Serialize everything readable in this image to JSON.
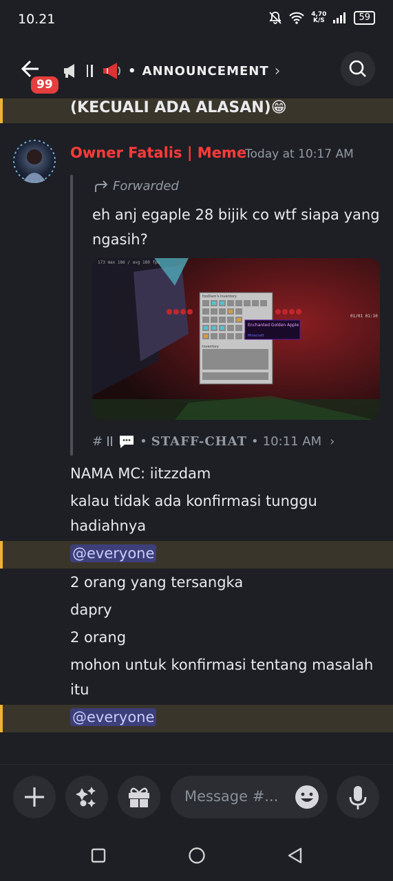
{
  "status": {
    "time": "10.21",
    "net_speed": "4,70",
    "net_unit": "K/S",
    "battery": "59"
  },
  "header": {
    "unread_count": "99",
    "bullet": "•",
    "channel_name": "ANNOUNCEMENT",
    "chevron": "›"
  },
  "messages": {
    "top_line": "(KECUALI ADA ALASAN)😁",
    "author": "Owner Fatalis | Meme",
    "timestamp": "Today at 10:17 AM",
    "forwarded_label": "Forwarded",
    "forwarded_text": "eh anj egaple 28 bijik co wtf siapa yang ngasih?",
    "forward_source": {
      "hash": "#",
      "channel": "STAFF-CHAT",
      "bullet": "•",
      "time": "10:11 AM",
      "chevron": "›"
    },
    "lines": [
      "NAMA MC: iitzzdam",
      "kalau tidak ada konfirmasi tunggu",
      "hadiahnya",
      "@everyone",
      "2 orang yang tersangka",
      "dapry",
      "2 orang",
      "mohon untuk konfirmasi tentang masalah",
      "itu",
      "@everyone"
    ]
  },
  "screenshot": {
    "inventory_title": "ItzzDam's Inventory",
    "inventory_label": "Inventory",
    "tooltip_title": "Enchanted Golden Apple",
    "tooltip_sub": "Minecraft"
  },
  "composer": {
    "placeholder": "Message #..."
  },
  "colors": {
    "accent_mention": "#3d3f7a",
    "username": "#ff3b3b",
    "highlight_border": "#f0b232",
    "badge": "#e53e3e"
  }
}
